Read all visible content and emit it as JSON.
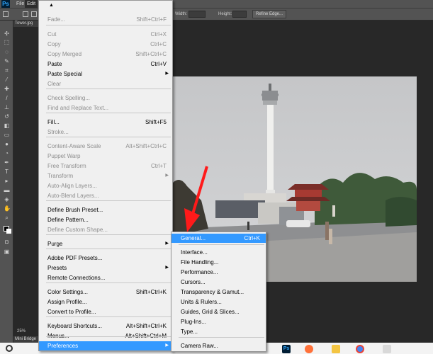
{
  "app": {
    "logo": "Ps",
    "menubar": {
      "file": "File",
      "edit": "Edit"
    },
    "options": {
      "width_label": "Width:",
      "height_label": "Height:",
      "refine_edge": "Refine Edge..."
    },
    "document_tab": "Tower.jpg",
    "zoom": "25%",
    "mini_bridge": "Mini Bridge"
  },
  "edit_menu": {
    "items": [
      {
        "label": "Fade...",
        "shortcut": "Shift+Ctrl+F",
        "disabled": true
      },
      {
        "label": "Cut",
        "shortcut": "Ctrl+X",
        "disabled": true
      },
      {
        "label": "Copy",
        "shortcut": "Ctrl+C",
        "disabled": true
      },
      {
        "label": "Copy Merged",
        "shortcut": "Shift+Ctrl+C",
        "disabled": true
      },
      {
        "label": "Paste",
        "shortcut": "Ctrl+V",
        "disabled": false
      },
      {
        "label": "Paste Special",
        "shortcut": "",
        "disabled": false,
        "submenu": true
      },
      {
        "label": "Clear",
        "shortcut": "",
        "disabled": true
      },
      {
        "label": "Check Spelling...",
        "shortcut": "",
        "disabled": true
      },
      {
        "label": "Find and Replace Text...",
        "shortcut": "",
        "disabled": true
      },
      {
        "label": "Fill...",
        "shortcut": "Shift+F5",
        "disabled": false
      },
      {
        "label": "Stroke...",
        "shortcut": "",
        "disabled": true
      },
      {
        "label": "Content-Aware Scale",
        "shortcut": "Alt+Shift+Ctrl+C",
        "disabled": true
      },
      {
        "label": "Puppet Warp",
        "shortcut": "",
        "disabled": true
      },
      {
        "label": "Free Transform",
        "shortcut": "Ctrl+T",
        "disabled": true
      },
      {
        "label": "Transform",
        "shortcut": "",
        "disabled": true,
        "submenu": true
      },
      {
        "label": "Auto-Align Layers...",
        "shortcut": "",
        "disabled": true
      },
      {
        "label": "Auto-Blend Layers...",
        "shortcut": "",
        "disabled": true
      },
      {
        "label": "Define Brush Preset...",
        "shortcut": "",
        "disabled": false
      },
      {
        "label": "Define Pattern...",
        "shortcut": "",
        "disabled": false
      },
      {
        "label": "Define Custom Shape...",
        "shortcut": "",
        "disabled": true
      },
      {
        "label": "Purge",
        "shortcut": "",
        "disabled": false,
        "submenu": true
      },
      {
        "label": "Adobe PDF Presets...",
        "shortcut": "",
        "disabled": false
      },
      {
        "label": "Presets",
        "shortcut": "",
        "disabled": false,
        "submenu": true
      },
      {
        "label": "Remote Connections...",
        "shortcut": "",
        "disabled": false
      },
      {
        "label": "Color Settings...",
        "shortcut": "Shift+Ctrl+K",
        "disabled": false
      },
      {
        "label": "Assign Profile...",
        "shortcut": "",
        "disabled": false
      },
      {
        "label": "Convert to Profile...",
        "shortcut": "",
        "disabled": false
      },
      {
        "label": "Keyboard Shortcuts...",
        "shortcut": "Alt+Shift+Ctrl+K",
        "disabled": false
      },
      {
        "label": "Menus...",
        "shortcut": "Alt+Shift+Ctrl+M",
        "disabled": false
      },
      {
        "label": "Preferences",
        "shortcut": "",
        "disabled": false,
        "submenu": true,
        "highlight": true
      }
    ]
  },
  "preferences_submenu": {
    "items": [
      {
        "label": "General...",
        "shortcut": "Ctrl+K",
        "highlight": true
      },
      {
        "label": "Interface...",
        "shortcut": ""
      },
      {
        "label": "File Handling...",
        "shortcut": ""
      },
      {
        "label": "Performance...",
        "shortcut": ""
      },
      {
        "label": "Cursors...",
        "shortcut": ""
      },
      {
        "label": "Transparency & Gamut...",
        "shortcut": ""
      },
      {
        "label": "Units & Rulers...",
        "shortcut": ""
      },
      {
        "label": "Guides, Grid & Slices...",
        "shortcut": ""
      },
      {
        "label": "Plug-Ins...",
        "shortcut": ""
      },
      {
        "label": "Type...",
        "shortcut": ""
      },
      {
        "label": "Camera Raw...",
        "shortcut": ""
      }
    ]
  },
  "colors": {
    "highlight": "#3399ff",
    "annotation_arrow": "#ff1a1a"
  }
}
